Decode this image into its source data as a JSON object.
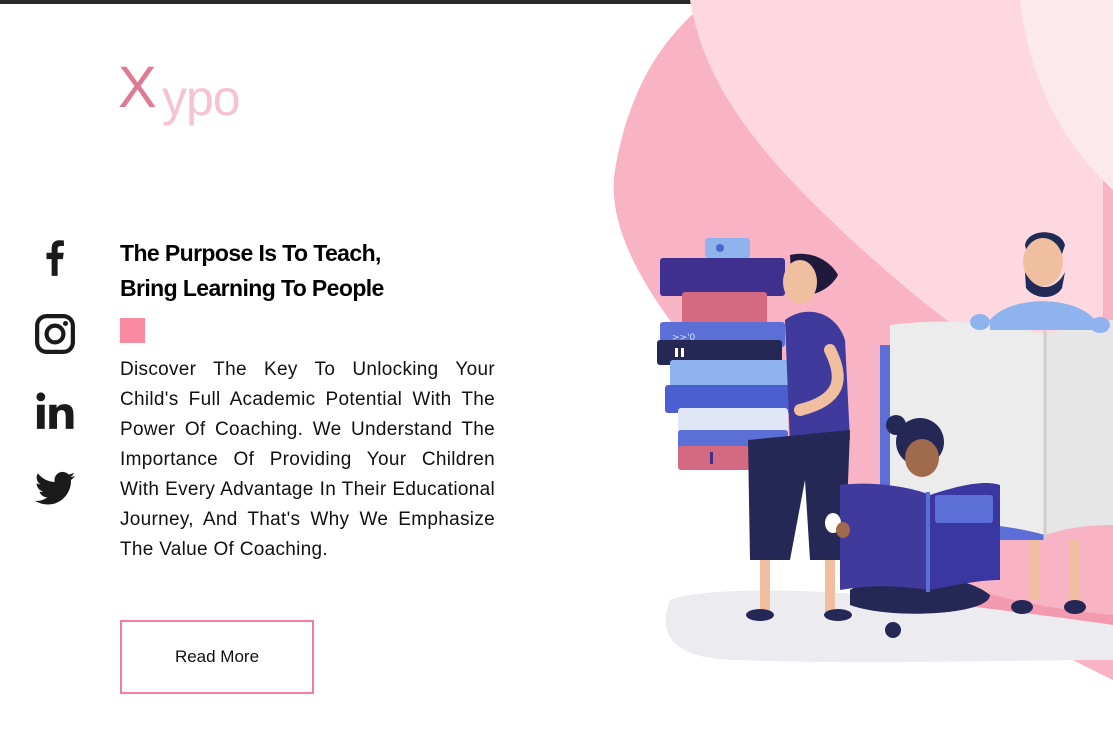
{
  "brand": {
    "logo_x": "X",
    "logo_rest": "ypo"
  },
  "social": [
    {
      "name": "facebook-icon"
    },
    {
      "name": "instagram-icon"
    },
    {
      "name": "linkedin-icon"
    },
    {
      "name": "twitter-icon"
    }
  ],
  "hero": {
    "heading_line1": "The Purpose Is To Teach,",
    "heading_line2": "Bring Learning To People",
    "description": "Discover The Key To Unlocking Your Child's Full Academic Potential With The Power Of Coaching. We Understand The Importance Of Providing Your Children With Every Advantage In Their Educational Journey, And That's Why We Emphasize The Value Of Coaching.",
    "cta_label": "Read More"
  },
  "colors": {
    "accent": "#f98aa0",
    "logo_x": "#e07a93",
    "logo_rest": "#f6c3d0",
    "button_border": "#f67e9b"
  }
}
